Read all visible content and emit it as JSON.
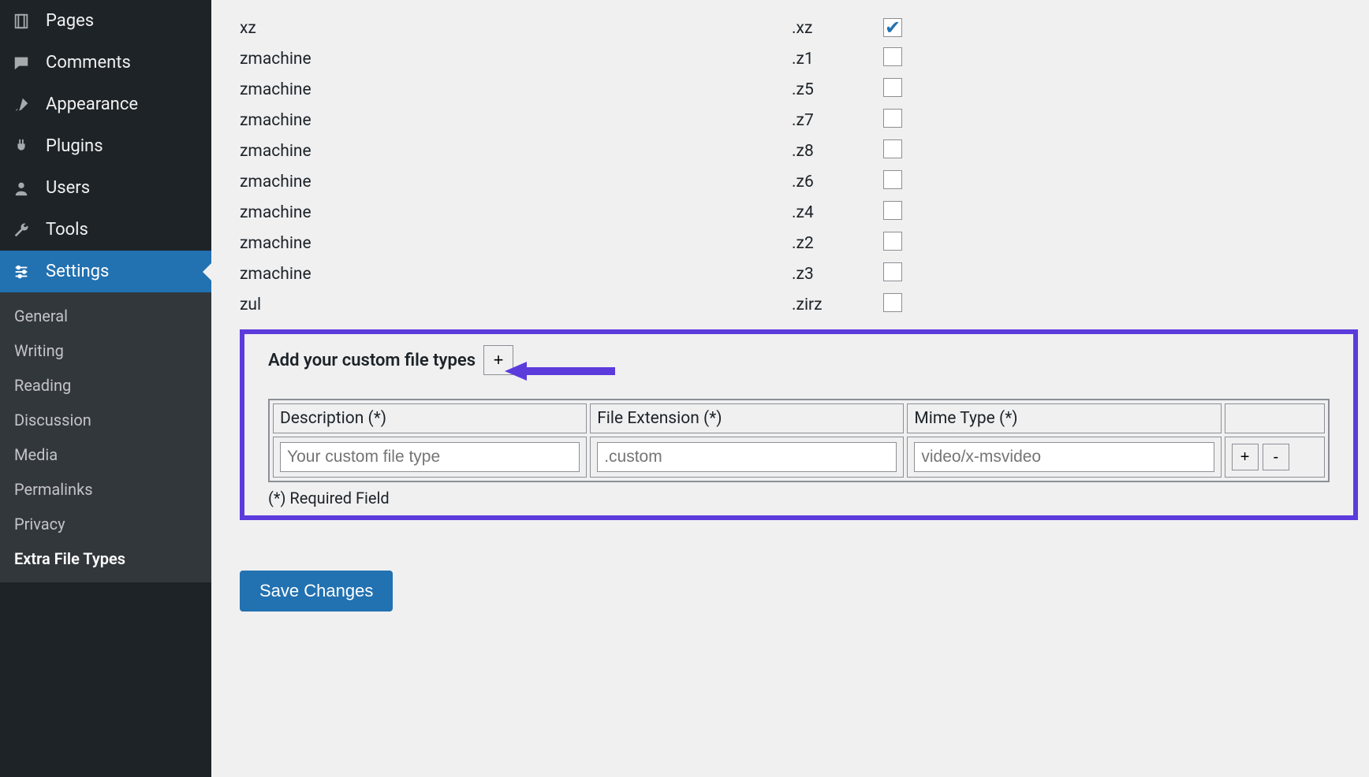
{
  "sidebar": {
    "items": [
      {
        "label": "Pages",
        "icon": "page"
      },
      {
        "label": "Comments",
        "icon": "comment"
      },
      {
        "label": "Appearance",
        "icon": "brush"
      },
      {
        "label": "Plugins",
        "icon": "plug"
      },
      {
        "label": "Users",
        "icon": "user"
      },
      {
        "label": "Tools",
        "icon": "wrench"
      },
      {
        "label": "Settings",
        "icon": "sliders",
        "active": true
      }
    ],
    "submenu": [
      {
        "label": "General"
      },
      {
        "label": "Writing"
      },
      {
        "label": "Reading"
      },
      {
        "label": "Discussion"
      },
      {
        "label": "Media"
      },
      {
        "label": "Permalinks"
      },
      {
        "label": "Privacy"
      },
      {
        "label": "Extra File Types",
        "current": true
      }
    ]
  },
  "file_rows": [
    {
      "name": "xz",
      "ext": ".xz",
      "checked": true
    },
    {
      "name": "zmachine",
      "ext": ".z1",
      "checked": false
    },
    {
      "name": "zmachine",
      "ext": ".z5",
      "checked": false
    },
    {
      "name": "zmachine",
      "ext": ".z7",
      "checked": false
    },
    {
      "name": "zmachine",
      "ext": ".z8",
      "checked": false
    },
    {
      "name": "zmachine",
      "ext": ".z6",
      "checked": false
    },
    {
      "name": "zmachine",
      "ext": ".z4",
      "checked": false
    },
    {
      "name": "zmachine",
      "ext": ".z2",
      "checked": false
    },
    {
      "name": "zmachine",
      "ext": ".z3",
      "checked": false
    },
    {
      "name": "zul",
      "ext": ".zirz",
      "checked": false
    }
  ],
  "custom": {
    "title": "Add your custom file types",
    "plus": "+",
    "headers": {
      "desc": "Description (*)",
      "ext": "File Extension (*)",
      "mime": "Mime Type (*)"
    },
    "placeholders": {
      "desc": "Your custom file type",
      "ext": ".custom",
      "mime": "video/x-msvideo"
    },
    "add": "+",
    "remove": "-",
    "required_note": "(*) Required Field"
  },
  "save_label": "Save Changes"
}
